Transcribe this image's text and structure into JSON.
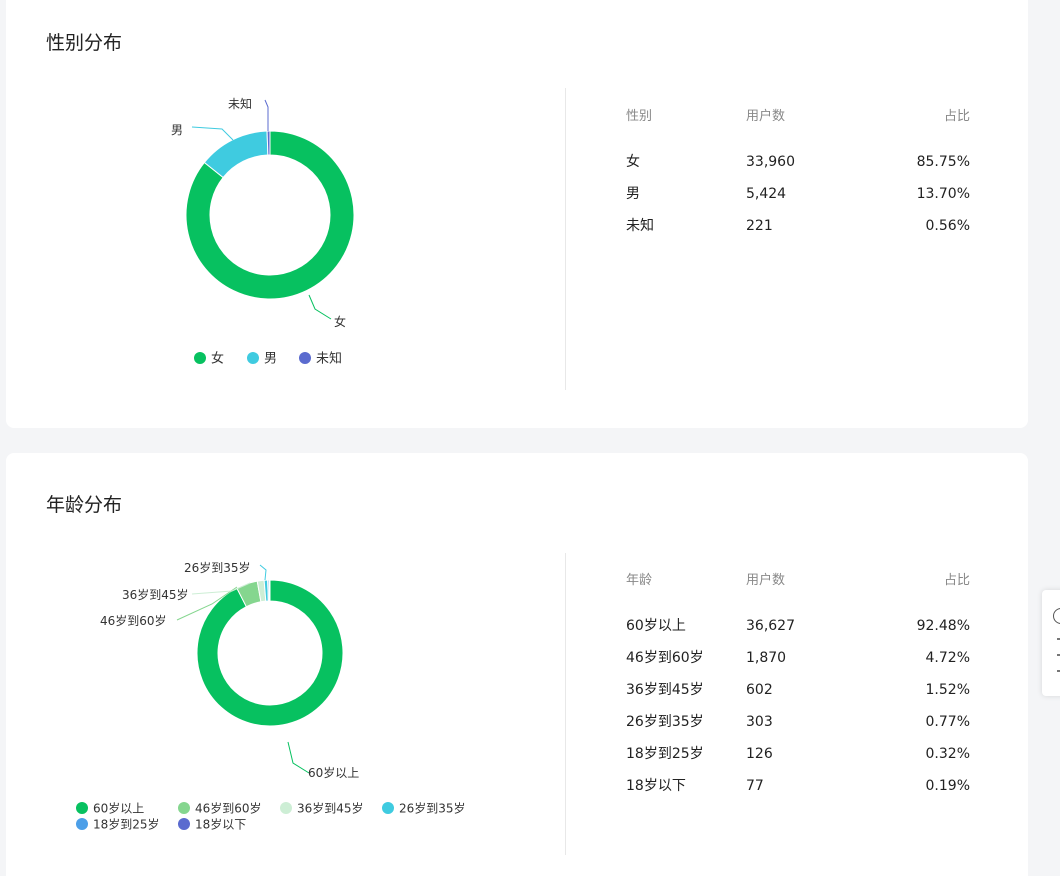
{
  "gender_section": {
    "title": "性别分布",
    "table": {
      "headers": [
        "性别",
        "用户数",
        "占比"
      ],
      "rows": [
        [
          "女",
          "33,960",
          "85.75%"
        ],
        [
          "男",
          "5,424",
          "13.70%"
        ],
        [
          "未知",
          "221",
          "0.56%"
        ]
      ]
    }
  },
  "age_section": {
    "title": "年龄分布",
    "table": {
      "headers": [
        "年龄",
        "用户数",
        "占比"
      ],
      "rows": [
        [
          "60岁以上",
          "36,627",
          "92.48%"
        ],
        [
          "46岁到60岁",
          "1,870",
          "4.72%"
        ],
        [
          "36岁到45岁",
          "602",
          "1.52%"
        ],
        [
          "26岁到35岁",
          "303",
          "0.77%"
        ],
        [
          "18岁到25岁",
          "126",
          "0.32%"
        ],
        [
          "18岁以下",
          "77",
          "0.19%"
        ]
      ]
    }
  },
  "chart_data": [
    {
      "type": "pie",
      "chart_style": "donut",
      "categories": [
        "女",
        "男",
        "未知"
      ],
      "values": [
        33960,
        5424,
        221
      ],
      "colors": [
        "#07c160",
        "#3fcbe0",
        "#5b6bcf"
      ],
      "outside_labels": [
        "女",
        "男",
        "未知"
      ],
      "legend": [
        "女",
        "男",
        "未知"
      ],
      "legend_position": "bottom"
    },
    {
      "type": "pie",
      "chart_style": "donut",
      "categories": [
        "60岁以上",
        "46岁到60岁",
        "36岁到45岁",
        "26岁到35岁",
        "18岁到25岁",
        "18岁以下"
      ],
      "values": [
        36627,
        1870,
        602,
        303,
        126,
        77
      ],
      "colors": [
        "#07c160",
        "#85d68f",
        "#cdeed5",
        "#3fcbe0",
        "#4c9fe8",
        "#5b6bcf"
      ],
      "outside_labels": [
        "60岁以上",
        "46岁到60岁",
        "36岁到45岁",
        "26岁到35岁"
      ],
      "legend": [
        "60岁以上",
        "46岁到60岁",
        "36岁到45岁",
        "26岁到35岁",
        "18岁到25岁",
        "18岁以下"
      ],
      "legend_position": "bottom"
    }
  ]
}
